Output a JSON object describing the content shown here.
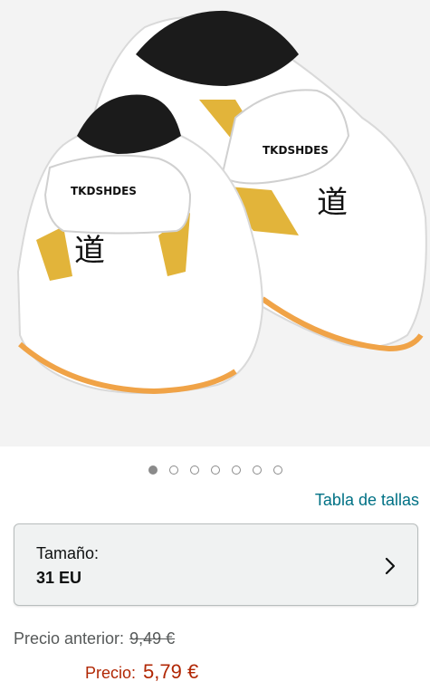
{
  "product": {
    "image_icon": "product-photo",
    "brand_text": "TKDSHDES",
    "emblem_char": "道"
  },
  "carousel": {
    "dots": [
      {
        "state": "active"
      },
      {
        "state": "inactive"
      },
      {
        "state": "inactive"
      },
      {
        "state": "inactive"
      },
      {
        "state": "inactive"
      },
      {
        "state": "inactive"
      },
      {
        "state": "inactive"
      }
    ]
  },
  "links": {
    "size_chart": "Tabla de tallas"
  },
  "size_selector": {
    "label": "Tamaño:",
    "value": "31 EU",
    "icon": "chevron-right-icon"
  },
  "pricing": {
    "previous_label": "Precio anterior:",
    "previous_value": "9,49 €",
    "current_label": "Precio:",
    "current_value": "5,79 €"
  },
  "colors": {
    "link": "#007185",
    "price": "#B12704",
    "muted": "#565959",
    "accent_gold": "#E2B43A"
  }
}
